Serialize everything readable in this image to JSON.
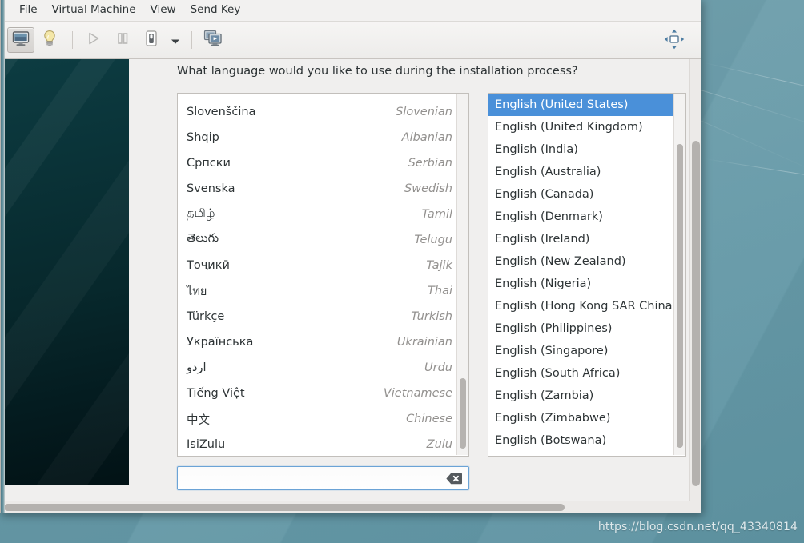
{
  "desktop": {
    "watermark": "https://blog.csdn.net/qq_43340814",
    "background_color": "#6f9fac"
  },
  "window": {
    "menubar": [
      {
        "label": "File",
        "name": "menu-file"
      },
      {
        "label": "Virtual Machine",
        "name": "menu-virtual-machine"
      },
      {
        "label": "View",
        "name": "menu-view"
      },
      {
        "label": "Send Key",
        "name": "menu-send-key"
      }
    ],
    "toolbar": [
      {
        "name": "show-console-button",
        "icon": "monitor-icon",
        "active": true
      },
      {
        "name": "show-details-button",
        "icon": "lightbulb-icon",
        "active": false
      },
      {
        "name": "run-button",
        "icon": "play-icon",
        "active": false
      },
      {
        "name": "pause-button",
        "icon": "pause-icon",
        "active": false
      },
      {
        "name": "shutdown-button",
        "icon": "power-icon",
        "active": false
      },
      {
        "name": "shutdown-dropdown-button",
        "icon": "chevron-down-icon",
        "active": false
      },
      {
        "name": "snapshots-button",
        "icon": "snapshots-icon",
        "active": false
      },
      {
        "name": "fullscreen-button",
        "icon": "fit-to-screen-icon",
        "active": false
      }
    ]
  },
  "installer": {
    "prompt": "What language would you like to use during the installation process?",
    "languages": [
      {
        "native": "Slovenščina",
        "english": "Slovenian"
      },
      {
        "native": "Shqip",
        "english": "Albanian"
      },
      {
        "native": "Српски",
        "english": "Serbian"
      },
      {
        "native": "Svenska",
        "english": "Swedish"
      },
      {
        "native": "தமிழ்",
        "english": "Tamil"
      },
      {
        "native": "తెలుగు",
        "english": "Telugu"
      },
      {
        "native": "Тоҷикӣ",
        "english": "Tajik"
      },
      {
        "native": "ไทย",
        "english": "Thai"
      },
      {
        "native": "Türkçe",
        "english": "Turkish"
      },
      {
        "native": "Українська",
        "english": "Ukrainian"
      },
      {
        "native": "اردو",
        "english": "Urdu"
      },
      {
        "native": "Tiếng Việt",
        "english": "Vietnamese"
      },
      {
        "native": "中文",
        "english": "Chinese"
      },
      {
        "native": "IsiZulu",
        "english": "Zulu"
      }
    ],
    "locales": [
      {
        "label": "English (United States)",
        "selected": true
      },
      {
        "label": "English (United Kingdom)",
        "selected": false
      },
      {
        "label": "English (India)",
        "selected": false
      },
      {
        "label": "English (Australia)",
        "selected": false
      },
      {
        "label": "English (Canada)",
        "selected": false
      },
      {
        "label": "English (Denmark)",
        "selected": false
      },
      {
        "label": "English (Ireland)",
        "selected": false
      },
      {
        "label": "English (New Zealand)",
        "selected": false
      },
      {
        "label": "English (Nigeria)",
        "selected": false
      },
      {
        "label": "English (Hong Kong SAR China)",
        "selected": false
      },
      {
        "label": "English (Philippines)",
        "selected": false
      },
      {
        "label": "English (Singapore)",
        "selected": false
      },
      {
        "label": "English (South Africa)",
        "selected": false
      },
      {
        "label": "English (Zambia)",
        "selected": false
      },
      {
        "label": "English (Zimbabwe)",
        "selected": false
      },
      {
        "label": "English (Botswana)",
        "selected": false
      }
    ],
    "search": {
      "value": "",
      "placeholder": "",
      "clear_icon": "clear-backspace-icon"
    },
    "selection_color": "#4a90d9"
  }
}
